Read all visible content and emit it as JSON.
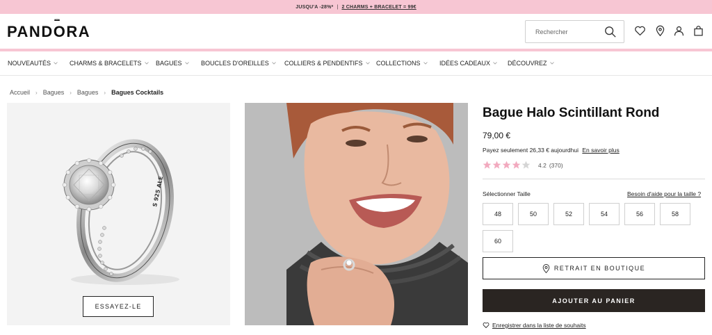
{
  "promo": {
    "text1": "JUSQU'A -28%*",
    "separator": "|",
    "link": "2 CHARMS + BRACELET = 99€"
  },
  "header": {
    "logo": "PANDORA",
    "search_placeholder": "Rechercher"
  },
  "nav": [
    {
      "label": "NOUVEAUTÉS"
    },
    {
      "label": "CHARMS & BRACELETS"
    },
    {
      "label": "BAGUES"
    },
    {
      "label": "BOUCLES D'OREILLES"
    },
    {
      "label": "COLLIERS & PENDENTIFS"
    },
    {
      "label": "COLLECTIONS"
    },
    {
      "label": "IDÉES CADEAUX"
    },
    {
      "label": "DÉCOUVREZ"
    }
  ],
  "breadcrumbs": [
    "Accueil",
    "Bagues",
    "Bagues",
    "Bagues Cocktails"
  ],
  "gallery": {
    "try_on": "ESSAYEZ-LE",
    "ring_engraving": "S 925 ALE"
  },
  "product": {
    "title": "Bague Halo Scintillant Rond",
    "price": "79,00 €",
    "pay_text": "Payez seulement 26,33 € aujourdhui",
    "pay_link": "En savoir plus",
    "rating": 4.2,
    "rating_text": "4.2",
    "reviews": "(370)",
    "size_label": "Sélectionner Taille",
    "size_help": "Besoin d'aide pour la taille ?",
    "sizes": [
      "48",
      "50",
      "52",
      "54",
      "56",
      "58",
      "60"
    ],
    "store_button": "RETRAIT EN BOUTIQUE",
    "cart_button": "AJOUTER AU PANIER",
    "wishlist": "Enregistrer dans la liste de souhaits"
  },
  "colors": {
    "promo_bg": "#f7c6d3",
    "star_filled": "#f2aabf",
    "star_empty": "#d5d5d5",
    "cart_bg": "#2a2522"
  }
}
